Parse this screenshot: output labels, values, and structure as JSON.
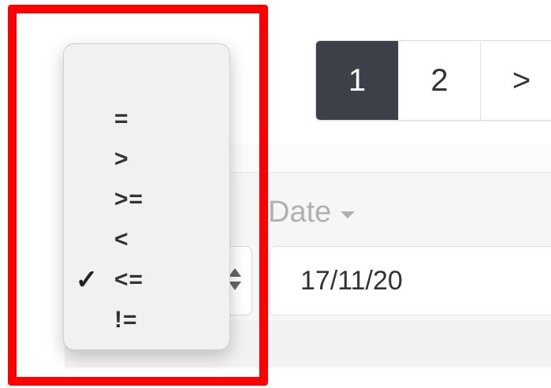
{
  "pagination": {
    "pages": [
      "1",
      "2",
      ">"
    ],
    "active_page": "1"
  },
  "table": {
    "date_column_header": "Date",
    "date_filter_value": "17/11/20"
  },
  "operator_menu": {
    "items": [
      "=",
      ">",
      ">=",
      "<",
      "<=",
      "!="
    ],
    "selected": "<=",
    "check_glyph": "✓"
  },
  "colors": {
    "highlight": "#ff0000",
    "active_page_bg": "#3d4048"
  },
  "icons": {
    "sort": "caret-down-icon",
    "select": "up-down-arrows-icon",
    "check": "checkmark-icon"
  }
}
